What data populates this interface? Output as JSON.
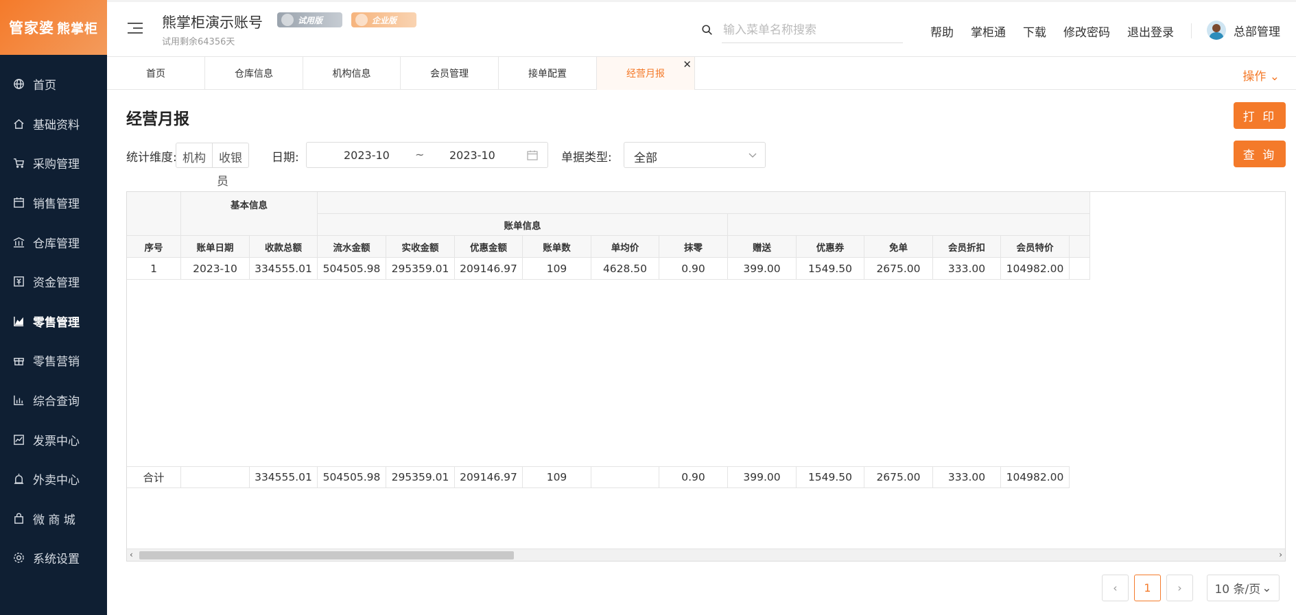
{
  "brand": {
    "logo_main": "管家婆",
    "logo_sub": "熊掌柜"
  },
  "sidebar": {
    "items": [
      {
        "label": "首页",
        "icon": "globe-icon"
      },
      {
        "label": "基础资料",
        "icon": "home-icon"
      },
      {
        "label": "采购管理",
        "icon": "cart-icon"
      },
      {
        "label": "销售管理",
        "icon": "calendar-icon"
      },
      {
        "label": "仓库管理",
        "icon": "bank-icon"
      },
      {
        "label": "资金管理",
        "icon": "money-icon"
      },
      {
        "label": "零售管理",
        "icon": "area-chart-icon",
        "active": true
      },
      {
        "label": "零售营销",
        "icon": "gift-icon"
      },
      {
        "label": "综合查询",
        "icon": "bar-chart-icon"
      },
      {
        "label": "发票中心",
        "icon": "line-chart-icon"
      },
      {
        "label": "外卖中心",
        "icon": "alarm-icon"
      },
      {
        "label": "微 商 城",
        "icon": "bag-icon"
      },
      {
        "label": "系统设置",
        "icon": "gear-icon"
      }
    ]
  },
  "header": {
    "account_name": "熊掌柜演示账号",
    "trial_left": "试用剩余64356天",
    "badge_trial": "试用版",
    "badge_enterprise": "企业版",
    "search_placeholder": "输入菜单名称搜索",
    "links": [
      "帮助",
      "掌柜通",
      "下载",
      "修改密码",
      "退出登录"
    ],
    "user_name": "总部管理"
  },
  "tabs": [
    {
      "label": "首页"
    },
    {
      "label": "仓库信息"
    },
    {
      "label": "机构信息"
    },
    {
      "label": "会员管理"
    },
    {
      "label": "接单配置"
    },
    {
      "label": "经营月报",
      "active": true
    }
  ],
  "ops_label": "操作",
  "page": {
    "title": "经营月报",
    "print_button": "打 印",
    "query_button": "查 询"
  },
  "filters": {
    "dimension_label": "统计维度:",
    "dimension_options": [
      "机构",
      "收银"
    ],
    "dimension_wrap": "员",
    "date_label": "日期:",
    "date_start": "2023-10",
    "date_sep": "~",
    "date_end": "2023-10",
    "type_label": "单据类型:",
    "type_value": "全部"
  },
  "table": {
    "group_basic": "基本信息",
    "group_bill": "账单信息",
    "columns": [
      "序号",
      "账单日期",
      "收款总额",
      "流水金额",
      "实收金额",
      "优惠金额",
      "账单数",
      "单均价",
      "抹零",
      "赠送",
      "优惠券",
      "免单",
      "会员折扣",
      "会员特价"
    ],
    "rows": [
      [
        "1",
        "2023-10",
        "334555.01",
        "504505.98",
        "295359.01",
        "209146.97",
        "109",
        "4628.50",
        "0.90",
        "399.00",
        "1549.50",
        "2675.00",
        "333.00",
        "104982.00"
      ]
    ],
    "total": [
      "合计",
      "",
      "334555.01",
      "504505.98",
      "295359.01",
      "209146.97",
      "109",
      "",
      "0.90",
      "399.00",
      "1549.50",
      "2675.00",
      "333.00",
      "104982.00"
    ]
  },
  "pagination": {
    "current": "1",
    "prev": "‹",
    "next": "›",
    "page_size": "10 条/页"
  },
  "colors": {
    "accent": "#f47a2a",
    "sidebar_bg": "#0f1f33"
  }
}
